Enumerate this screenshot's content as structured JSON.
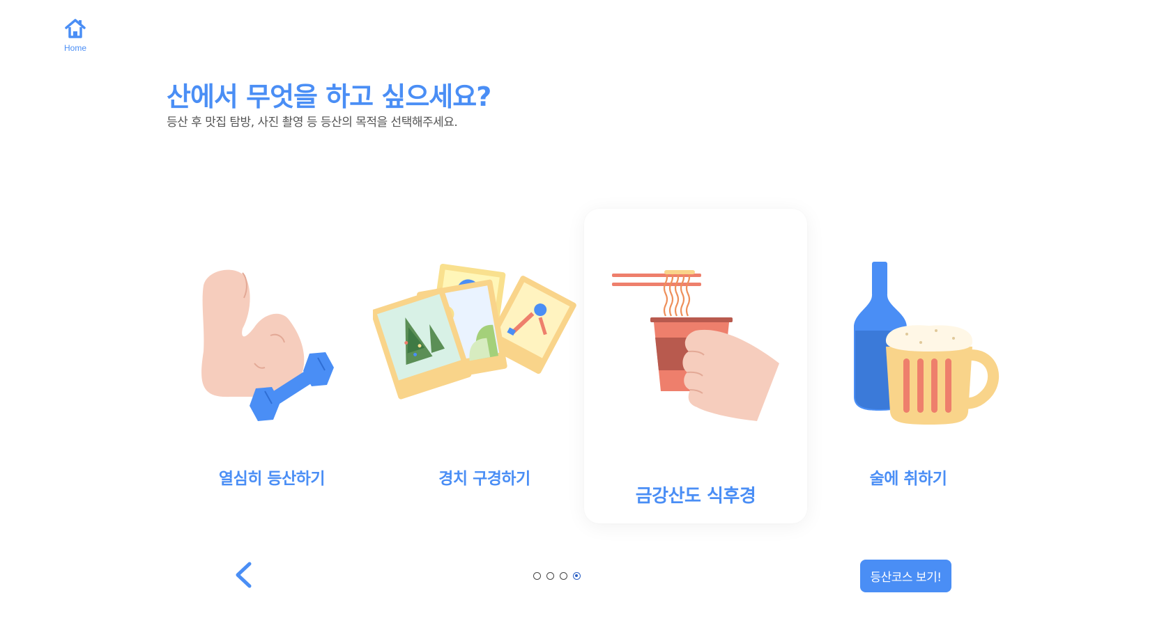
{
  "nav": {
    "home_label": "Home"
  },
  "heading": {
    "title": "산에서 무엇을 하고 싶으세요?",
    "subtitle": "등산 후 맛집 탐방, 사진 촬영 등 등산의 목적을 선택해주세요."
  },
  "options": [
    {
      "label": "열심히 등산하기",
      "icon": "dumbbell-arm-illustration",
      "selected": false
    },
    {
      "label": "경치 구경하기",
      "icon": "photos-illustration",
      "selected": false
    },
    {
      "label": "금강산도 식후경",
      "icon": "noodle-cup-illustration",
      "selected": true
    },
    {
      "label": "술에 취하기",
      "icon": "bottle-beer-illustration",
      "selected": false
    }
  ],
  "pagination": {
    "total": 4,
    "current": 4
  },
  "actions": {
    "view_course_label": "등산코스 보기!"
  },
  "colors": {
    "accent": "#4a8ef5",
    "dark_blue": "#2a5fc4"
  }
}
